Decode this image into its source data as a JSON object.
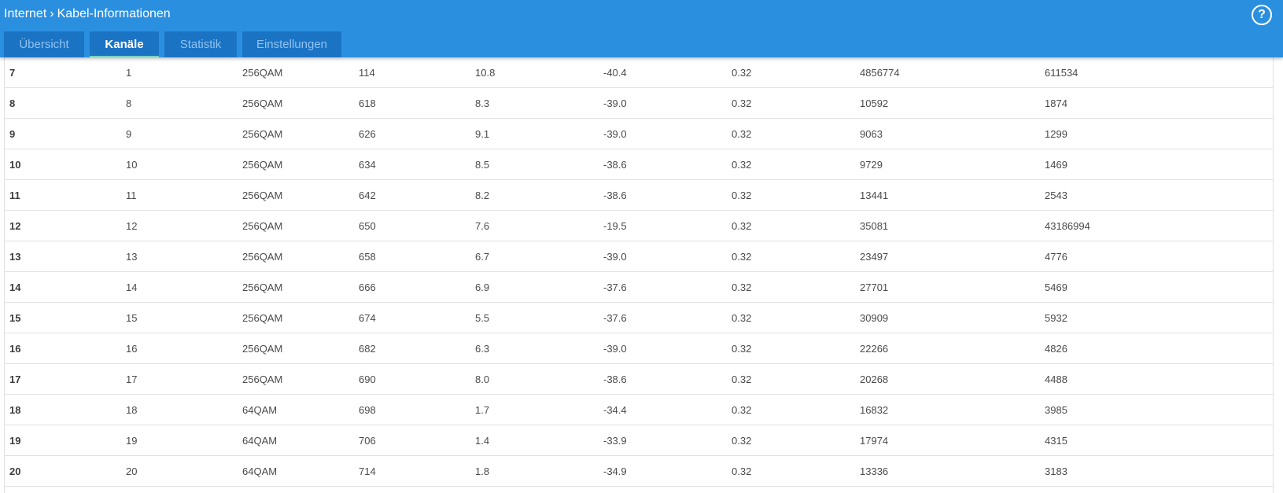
{
  "header": {
    "breadcrumb_parent": "Internet",
    "breadcrumb_current": "Kabel-Informationen",
    "help_label": "?"
  },
  "tabs": [
    {
      "label": "Übersicht"
    },
    {
      "label": "Kanäle"
    },
    {
      "label": "Statistik"
    },
    {
      "label": "Einstellungen"
    }
  ],
  "active_tab": "Kanäle",
  "colors": {
    "header_bg": "#2b8fe0",
    "tab_bg": "#1b73c4",
    "tab_active_underline": "#7cd0c0"
  },
  "rows": [
    [
      "7",
      "1",
      "256QAM",
      "114",
      "10.8",
      "-40.4",
      "0.32",
      "4856774",
      "611534"
    ],
    [
      "8",
      "8",
      "256QAM",
      "618",
      "8.3",
      "-39.0",
      "0.32",
      "10592",
      "1874"
    ],
    [
      "9",
      "9",
      "256QAM",
      "626",
      "9.1",
      "-39.0",
      "0.32",
      "9063",
      "1299"
    ],
    [
      "10",
      "10",
      "256QAM",
      "634",
      "8.5",
      "-38.6",
      "0.32",
      "9729",
      "1469"
    ],
    [
      "11",
      "11",
      "256QAM",
      "642",
      "8.2",
      "-38.6",
      "0.32",
      "13441",
      "2543"
    ],
    [
      "12",
      "12",
      "256QAM",
      "650",
      "7.6",
      "-19.5",
      "0.32",
      "35081",
      "43186994"
    ],
    [
      "13",
      "13",
      "256QAM",
      "658",
      "6.7",
      "-39.0",
      "0.32",
      "23497",
      "4776"
    ],
    [
      "14",
      "14",
      "256QAM",
      "666",
      "6.9",
      "-37.6",
      "0.32",
      "27701",
      "5469"
    ],
    [
      "15",
      "15",
      "256QAM",
      "674",
      "5.5",
      "-37.6",
      "0.32",
      "30909",
      "5932"
    ],
    [
      "16",
      "16",
      "256QAM",
      "682",
      "6.3",
      "-39.0",
      "0.32",
      "22266",
      "4826"
    ],
    [
      "17",
      "17",
      "256QAM",
      "690",
      "8.0",
      "-38.6",
      "0.32",
      "20268",
      "4488"
    ],
    [
      "18",
      "18",
      "64QAM",
      "698",
      "1.7",
      "-34.4",
      "0.32",
      "16832",
      "3985"
    ],
    [
      "19",
      "19",
      "64QAM",
      "706",
      "1.4",
      "-33.9",
      "0.32",
      "17974",
      "4315"
    ],
    [
      "20",
      "20",
      "64QAM",
      "714",
      "1.8",
      "-34.9",
      "0.32",
      "13336",
      "3183"
    ]
  ]
}
